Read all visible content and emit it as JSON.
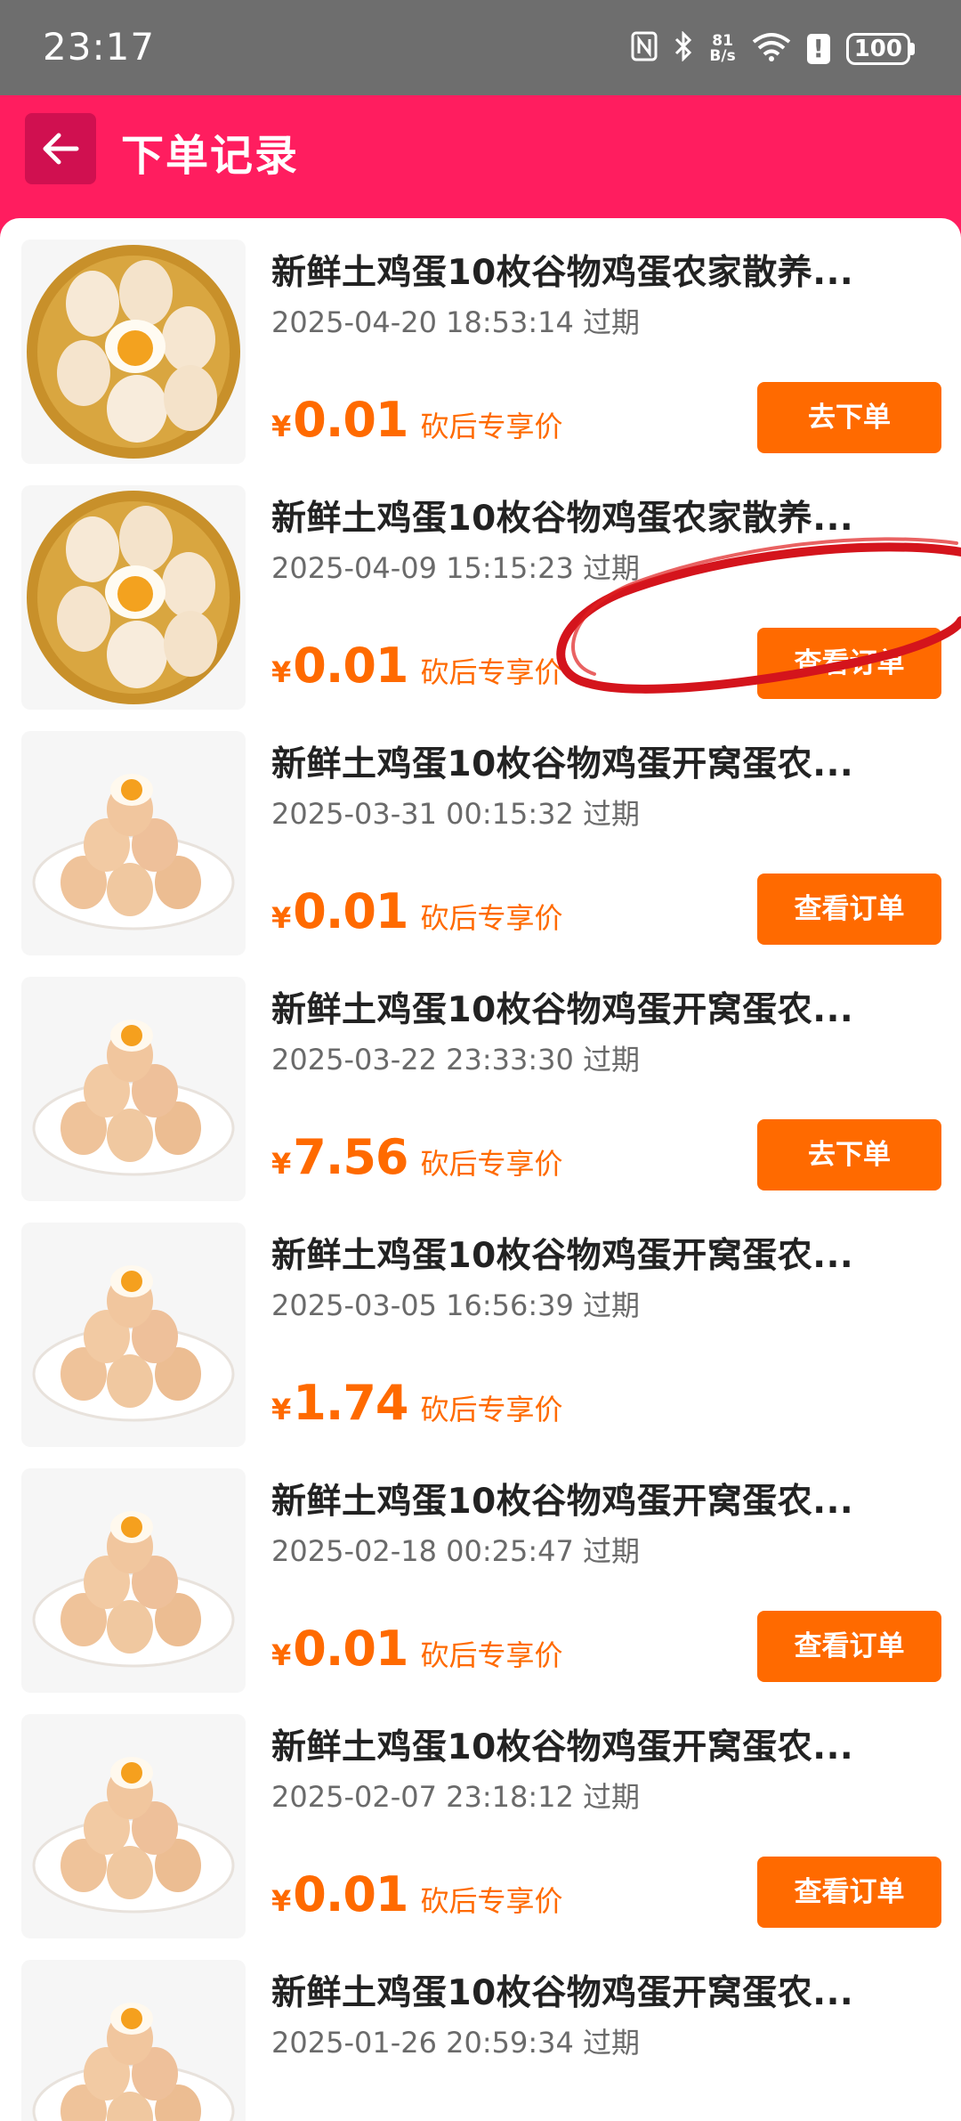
{
  "status_bar": {
    "time": "23:17",
    "net_speed_top": "81",
    "net_speed_bottom": "B/s",
    "battery": "100",
    "icons": [
      "nfc-icon",
      "bluetooth-icon",
      "wifi-icon",
      "alert-icon",
      "battery-icon"
    ]
  },
  "header": {
    "title": "下单记录",
    "back_icon": "arrow-left-icon"
  },
  "colors": {
    "brand": "#ff1d5f",
    "accent": "#ff6a00",
    "status_bar": "#6e6e6e"
  },
  "orders": [
    {
      "title": "新鲜土鸡蛋10枚谷物鸡蛋农家散养...",
      "date": "2025-04-20 18:53:14 过期",
      "currency": "¥",
      "price": "0.01",
      "price_note": "砍后专享价",
      "action": "去下单",
      "image": "egg-basket"
    },
    {
      "title": "新鲜土鸡蛋10枚谷物鸡蛋农家散养...",
      "date": "2025-04-09 15:15:23 过期",
      "currency": "¥",
      "price": "0.01",
      "price_note": "砍后专享价",
      "action": "查看订单",
      "image": "egg-basket"
    },
    {
      "title": "新鲜土鸡蛋10枚谷物鸡蛋开窝蛋农...",
      "date": "2025-03-31 00:15:32 过期",
      "currency": "¥",
      "price": "0.01",
      "price_note": "砍后专享价",
      "action": "查看订单",
      "image": "egg-plate"
    },
    {
      "title": "新鲜土鸡蛋10枚谷物鸡蛋开窝蛋农...",
      "date": "2025-03-22 23:33:30 过期",
      "currency": "¥",
      "price": "7.56",
      "price_note": "砍后专享价",
      "action": "去下单",
      "image": "egg-plate"
    },
    {
      "title": "新鲜土鸡蛋10枚谷物鸡蛋开窝蛋农...",
      "date": "2025-03-05 16:56:39 过期",
      "currency": "¥",
      "price": "1.74",
      "price_note": "砍后专享价",
      "action": "",
      "image": "egg-plate"
    },
    {
      "title": "新鲜土鸡蛋10枚谷物鸡蛋开窝蛋农...",
      "date": "2025-02-18 00:25:47 过期",
      "currency": "¥",
      "price": "0.01",
      "price_note": "砍后专享价",
      "action": "查看订单",
      "image": "egg-plate"
    },
    {
      "title": "新鲜土鸡蛋10枚谷物鸡蛋开窝蛋农...",
      "date": "2025-02-07 23:18:12 过期",
      "currency": "¥",
      "price": "0.01",
      "price_note": "砍后专享价",
      "action": "查看订单",
      "image": "egg-plate"
    },
    {
      "title": "新鲜土鸡蛋10枚谷物鸡蛋开窝蛋农...",
      "date": "2025-01-26 20:59:34 过期",
      "currency": "¥",
      "price": "",
      "price_note": "",
      "action": "",
      "image": "egg-plate"
    }
  ]
}
